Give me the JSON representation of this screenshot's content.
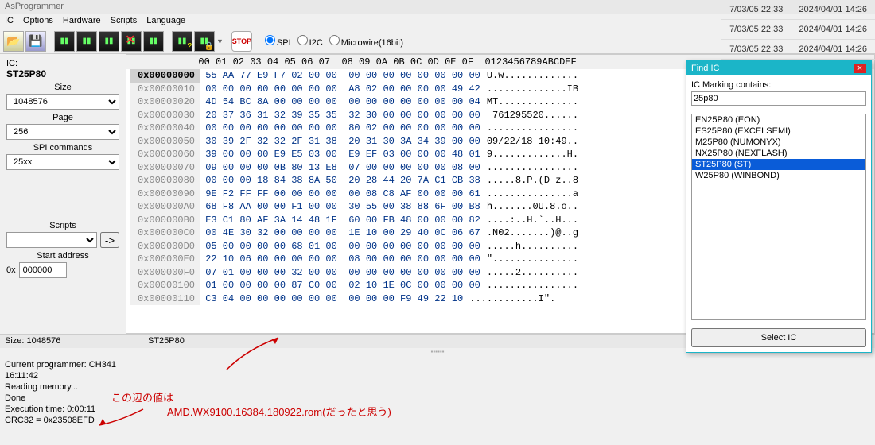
{
  "window": {
    "title": "AsProgrammer"
  },
  "menu": [
    "IC",
    "Options",
    "Hardware",
    "Scripts",
    "Language"
  ],
  "radios": {
    "spi": "SPI",
    "i2c": "I2C",
    "mw": "Microwire(16bit)",
    "selected": "spi"
  },
  "left": {
    "ic_label": "IC:",
    "ic_name": "ST25P80",
    "size_label": "Size",
    "size_value": "1048576",
    "page_label": "Page",
    "page_value": "256",
    "spi_label": "SPI commands",
    "spi_value": "25xx",
    "scripts_label": "Scripts",
    "scripts_value": "",
    "start_label": "Start address",
    "start_prefix": "0x",
    "start_value": "000000"
  },
  "hex": {
    "header": "00 01 02 03 04 05 06 07  08 09 0A 0B 0C 0D 0E 0F  0123456789ABCDEF",
    "rows": [
      {
        "addr": "0x00000000",
        "b": "55 AA 77 E9 F7 02 00 00  00 00 00 00 00 00 00 00",
        "a": "U.w.............",
        "sel": true
      },
      {
        "addr": "0x00000010",
        "b": "00 00 00 00 00 00 00 00  A8 02 00 00 00 00 49 42",
        "a": "..............IB"
      },
      {
        "addr": "0x00000020",
        "b": "4D 54 BC 8A 00 00 00 00  00 00 00 00 00 00 00 04",
        "a": "MT.............."
      },
      {
        "addr": "0x00000030",
        "b": "20 37 36 31 32 39 35 35  32 30 00 00 00 00 00 00",
        "a": " 761295520......"
      },
      {
        "addr": "0x00000040",
        "b": "00 00 00 00 00 00 00 00  80 02 00 00 00 00 00 00",
        "a": "................"
      },
      {
        "addr": "0x00000050",
        "b": "30 39 2F 32 32 2F 31 38  20 31 30 3A 34 39 00 00",
        "a": "09/22/18 10:49.."
      },
      {
        "addr": "0x00000060",
        "b": "39 00 00 00 E9 E5 03 00  E9 EF 03 00 00 00 48 01",
        "a": "9.............H."
      },
      {
        "addr": "0x00000070",
        "b": "09 00 00 00 0B 80 13 E8  07 00 00 00 00 00 08 00",
        "a": "................"
      },
      {
        "addr": "0x00000080",
        "b": "00 00 00 18 84 38 8A 50  20 28 44 20 7A C1 CB 38",
        "a": ".....8.P.(D z..8"
      },
      {
        "addr": "0x00000090",
        "b": "9E F2 FF FF 00 00 00 00  00 08 C8 AF 00 00 00 61",
        "a": "...............a"
      },
      {
        "addr": "0x000000A0",
        "b": "68 F8 AA 00 00 F1 00 00  30 55 00 38 88 6F 00 B8",
        "a": "h.......0U.8.o.."
      },
      {
        "addr": "0x000000B0",
        "b": "E3 C1 80 AF 3A 14 48 1F  60 00 FB 48 00 00 00 82",
        "a": "....:..H.`..H..."
      },
      {
        "addr": "0x000000C0",
        "b": "00 4E 30 32 00 00 00 00  1E 10 00 29 40 0C 06 67",
        "a": ".N02.......)@..g"
      },
      {
        "addr": "0x000000D0",
        "b": "05 00 00 00 00 68 01 00  00 00 00 00 00 00 00 00",
        "a": ".....h.........."
      },
      {
        "addr": "0x000000E0",
        "b": "22 10 06 00 00 00 00 00  08 00 00 00 00 00 00 00",
        "a": "\"..............."
      },
      {
        "addr": "0x000000F0",
        "b": "07 01 00 00 00 32 00 00  00 00 00 00 00 00 00 00",
        "a": ".....2.........."
      },
      {
        "addr": "0x00000100",
        "b": "01 00 00 00 00 87 C0 00  02 10 1E 0C 00 00 00 00",
        "a": "................"
      },
      {
        "addr": "0x00000110",
        "b": "C3 04 00 00 00 00 00 00  00 00 00 F9 49 22 10",
        "a": "............I\"."
      }
    ]
  },
  "status": {
    "size": "Size: 1048576",
    "ic": "ST25P80"
  },
  "log": "Current programmer: CH341\n16:11:42\nReading memory...\nDone\nExecution time: 0:00:11\nCRC32 = 0x23508EFD",
  "anno1": "この辺の値は",
  "anno2": "AMD.WX9100.16384.180922.rom(だったと思う)",
  "find": {
    "title": "Find IC",
    "label": "IC Marking contains:",
    "value": "25p80",
    "items": [
      "EN25P80 (EON)",
      "ES25P80 (EXCELSEMI)",
      "M25P80 (NUMONYX)",
      "NX25P80 (NEXFLASH)",
      "ST25P80 (ST)",
      "W25P80 (WINBOND)"
    ],
    "selected": 4,
    "button": "Select IC"
  },
  "bgtimes": [
    {
      "a": "7/03/05 22:33",
      "b": "2024/04/01 14:26"
    },
    {
      "a": "7/03/05 22:33",
      "b": "2024/04/01 14:26"
    },
    {
      "a": "7/03/05 22:33",
      "b": "2024/04/01 14:26"
    }
  ]
}
